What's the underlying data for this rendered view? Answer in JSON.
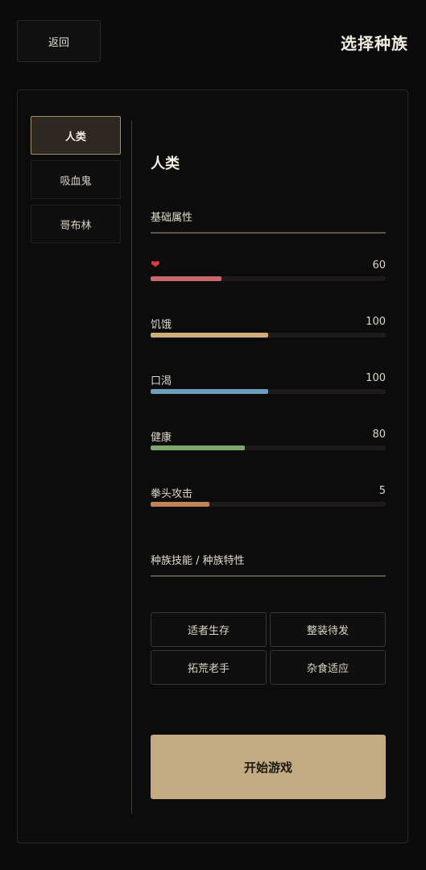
{
  "header": {
    "back_label": "返回",
    "title": "选择种族"
  },
  "races": {
    "items": [
      {
        "label": "人类",
        "selected": true
      },
      {
        "label": "吸血鬼",
        "selected": false
      },
      {
        "label": "哥布林",
        "selected": false
      }
    ]
  },
  "detail": {
    "race_name": "人类",
    "attributes_title": "基础属性",
    "stats": [
      {
        "label": "",
        "icon": "heart-icon",
        "value": "60",
        "fill": 0.3,
        "color": "#c9686a"
      },
      {
        "label": "饥饿",
        "value": "100",
        "fill": 0.5,
        "color": "#cfae7a"
      },
      {
        "label": "口渴",
        "value": "100",
        "fill": 0.5,
        "color": "#6a9ebc"
      },
      {
        "label": "健康",
        "value": "80",
        "fill": 0.4,
        "color": "#7ea76e"
      },
      {
        "label": "拳头攻击",
        "value": "5",
        "fill": 0.25,
        "color": "#c48354"
      }
    ],
    "skills_title": "种族技能 / 种族特性",
    "skills": [
      "适者生存",
      "整装待发",
      "拓荒老手",
      "杂食适应"
    ],
    "start_label": "开始游戏"
  }
}
